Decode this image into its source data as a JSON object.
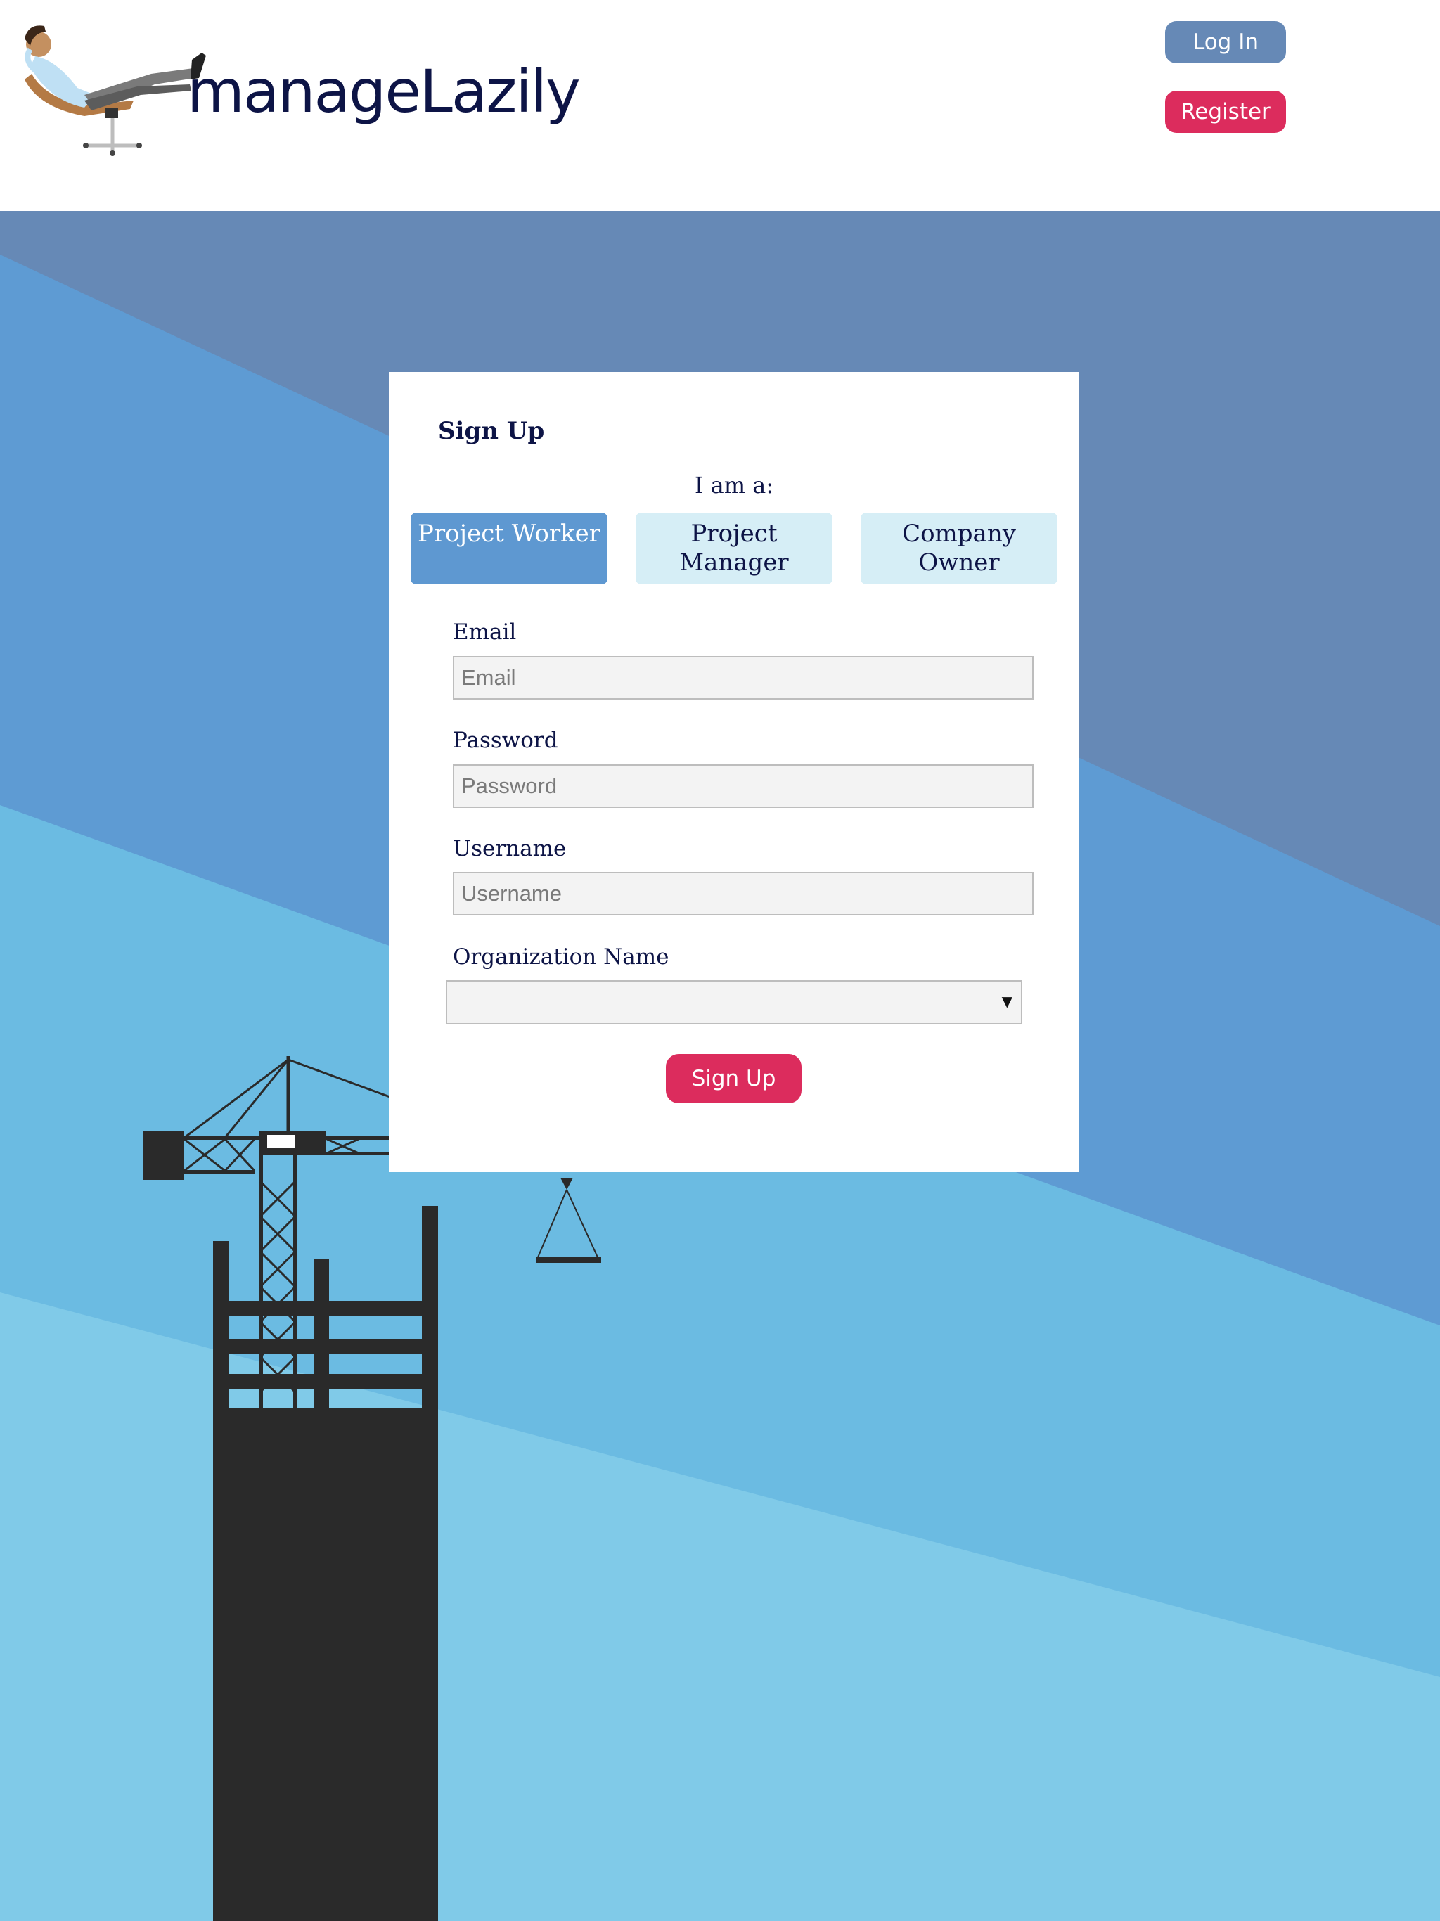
{
  "header": {
    "brand": "manageLazily",
    "login_label": "Log In",
    "register_label": "Register"
  },
  "signup": {
    "title": "Sign Up",
    "role_prompt": "I am a:",
    "roles": [
      {
        "label": "Project Worker",
        "active": true
      },
      {
        "label": "Project Manager",
        "active": false
      },
      {
        "label": "Company Owner",
        "active": false
      }
    ],
    "fields": {
      "email": {
        "label": "Email",
        "placeholder": "Email",
        "value": ""
      },
      "password": {
        "label": "Password",
        "placeholder": "Password",
        "value": ""
      },
      "username": {
        "label": "Username",
        "placeholder": "Username",
        "value": ""
      },
      "organization": {
        "label": "Organization Name",
        "selected": ""
      }
    },
    "submit_label": "Sign Up"
  },
  "colors": {
    "brand_text": "#0d1446",
    "login_button": "#6689b6",
    "accent_pink": "#dc2c5d",
    "role_active": "#5e98d1",
    "role_inactive": "#d6eef6",
    "sky_dark": "#6689b6",
    "sky_mid": "#5e9bd3",
    "sky_light": "#6bbbe2",
    "sky_lightest": "#80cae8",
    "silhouette": "#2a2a2a"
  },
  "icons": {
    "logo": "lazy-person-in-office-chair-icon",
    "select_caret": "triangle-down-icon",
    "background": "construction-crane-silhouette"
  }
}
